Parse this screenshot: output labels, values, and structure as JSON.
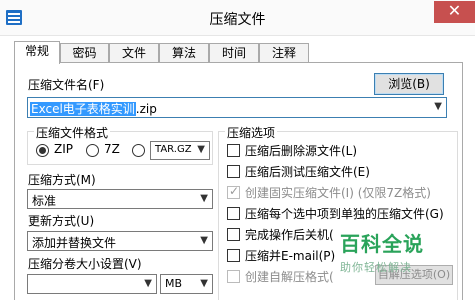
{
  "window": {
    "title": "压缩文件",
    "close_glyph": "✕"
  },
  "tabs": [
    {
      "label": "常规",
      "active": true
    },
    {
      "label": "密码"
    },
    {
      "label": "文件"
    },
    {
      "label": "算法"
    },
    {
      "label": "时间"
    },
    {
      "label": "注释"
    }
  ],
  "general": {
    "archive_name_label": "压缩文件名(F)",
    "browse_label": "浏览(B)",
    "archive_name_selected": "Excel电子表格实训",
    "archive_name_rest": ".zip",
    "format_group_title": "压缩文件格式",
    "format_options": [
      {
        "label": "ZIP",
        "checked": true
      },
      {
        "label": "7Z",
        "checked": false
      },
      {
        "label": "",
        "checked": false
      }
    ],
    "format_combo_value": "TAR.GZ",
    "method_label": "压缩方式(M)",
    "method_value": "标准",
    "update_label": "更新方式(U)",
    "update_value": "添加并替换文件",
    "split_label": "压缩分卷大小设置(V)",
    "split_value": "",
    "split_unit": "MB"
  },
  "options": {
    "group_title": "压缩选项",
    "items": [
      {
        "label": "压缩后删除源文件(L)",
        "checked": false,
        "disabled": false
      },
      {
        "label": "压缩后测试压缩文件(E)",
        "checked": false,
        "disabled": false
      },
      {
        "label": "创建固实压缩文件(I) (仅限7Z格式)",
        "checked": true,
        "disabled": true
      },
      {
        "label": "压缩每个选中项到单独的压缩文件(G)",
        "checked": false,
        "disabled": false
      },
      {
        "label": "完成操作后关机(",
        "checked": false,
        "disabled": false
      },
      {
        "label": "压缩并E-mail(P)",
        "checked": false,
        "disabled": false
      },
      {
        "label": "创建自解压格式(",
        "checked": false,
        "disabled": true
      }
    ],
    "sfx_options_label": "自解压选项(O)"
  },
  "watermark": {
    "main": "百科全说",
    "sub": "助你轻松解决"
  },
  "colors": {
    "close": "#c7504f",
    "selection": "#3399ff",
    "watermark": "#2aa35a"
  }
}
